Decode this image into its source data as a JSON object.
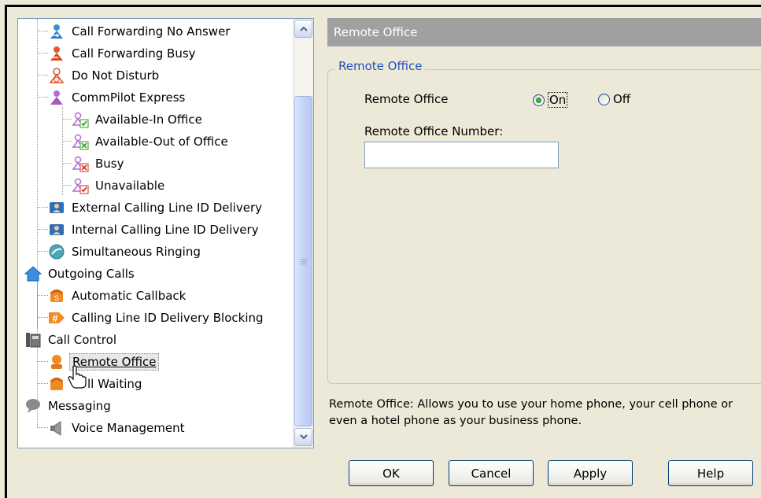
{
  "tree": {
    "items": [
      {
        "label": "Call Forwarding No Answer",
        "icon": "call-forwarding-icon"
      },
      {
        "label": "Call Forwarding Busy",
        "icon": "call-forwarding-busy-icon"
      },
      {
        "label": "Do Not Disturb",
        "icon": "do-not-disturb-icon"
      },
      {
        "label": "CommPilot Express",
        "icon": "commpilot-express-icon"
      },
      {
        "label": "Available-In Office",
        "icon": "available-in-office-icon"
      },
      {
        "label": "Available-Out of Office",
        "icon": "available-out-of-office-icon"
      },
      {
        "label": "Busy",
        "icon": "busy-icon"
      },
      {
        "label": "Unavailable",
        "icon": "unavailable-icon"
      },
      {
        "label": "External Calling Line ID Delivery",
        "icon": "caller-id-card-icon"
      },
      {
        "label": "Internal Calling Line ID Delivery",
        "icon": "caller-id-card-icon"
      },
      {
        "label": "Simultaneous Ringing",
        "icon": "simultaneous-ringing-icon"
      },
      {
        "label": "Outgoing Calls",
        "icon": "house-arrow-icon"
      },
      {
        "label": "Automatic Callback",
        "icon": "automatic-callback-icon"
      },
      {
        "label": "Calling Line ID Delivery Blocking",
        "icon": "id-blocking-icon"
      },
      {
        "label": "Call Control",
        "icon": "phone-icon"
      },
      {
        "label": "Remote Office",
        "icon": "remote-office-icon"
      },
      {
        "label": "ll Waiting",
        "icon": "call-waiting-icon"
      },
      {
        "label": "Messaging",
        "icon": "speech-bubble-icon"
      },
      {
        "label": "Voice Management",
        "icon": "speaker-icon"
      }
    ]
  },
  "panel": {
    "header_title": "Remote Office",
    "group_title": "Remote Office",
    "remote_office_label": "Remote Office",
    "radio_on_label": "On",
    "radio_off_label": "Off",
    "radio_selected": "On",
    "number_label": "Remote Office Number:",
    "number_value": "",
    "description": "Remote Office: Allows you to use your home phone, your cell phone or even a hotel phone as your business phone."
  },
  "buttons": {
    "ok": "OK",
    "cancel": "Cancel",
    "apply": "Apply",
    "help": "Help"
  },
  "colors": {
    "header_bg": "#a0a0a0",
    "group_title": "#2550b8",
    "dialog_bg": "#ece9d8"
  }
}
